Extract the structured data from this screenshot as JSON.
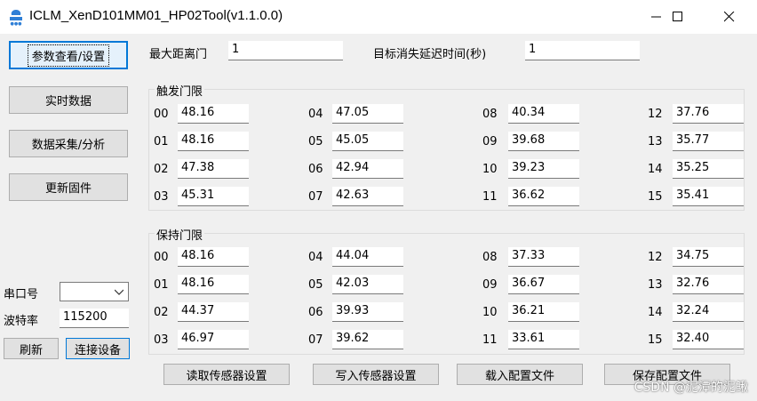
{
  "window": {
    "title": "ICLM_XenD101MM01_HP02Tool(v1.1.0.0)",
    "logo_icon": "app-logo-icon",
    "minimize_icon": "minimize-icon",
    "maximize_icon": "maximize-icon",
    "close_icon": "close-icon"
  },
  "sidebar": {
    "buttons": [
      "参数查看/设置",
      "实时数据",
      "数据采集/分析",
      "更新固件"
    ],
    "selected_index": 0
  },
  "connection": {
    "port_label": "串口号",
    "port_value": "",
    "baud_label": "波特率",
    "baud_value": "115200",
    "refresh_label": "刷新",
    "connect_label": "连接设备"
  },
  "settings": {
    "max_distance_label": "最大距离门",
    "max_distance_value": "1",
    "target_delay_label": "目标消失延迟时间(秒)",
    "target_delay_value": "1"
  },
  "trigger": {
    "title": "触发门限",
    "gates": [
      {
        "id": "00",
        "value": "48.16"
      },
      {
        "id": "01",
        "value": "48.16"
      },
      {
        "id": "02",
        "value": "47.38"
      },
      {
        "id": "03",
        "value": "45.31"
      },
      {
        "id": "04",
        "value": "47.05"
      },
      {
        "id": "05",
        "value": "45.05"
      },
      {
        "id": "06",
        "value": "42.94"
      },
      {
        "id": "07",
        "value": "42.63"
      },
      {
        "id": "08",
        "value": "40.34"
      },
      {
        "id": "09",
        "value": "39.68"
      },
      {
        "id": "10",
        "value": "39.23"
      },
      {
        "id": "11",
        "value": "36.62"
      },
      {
        "id": "12",
        "value": "37.76"
      },
      {
        "id": "13",
        "value": "35.77"
      },
      {
        "id": "14",
        "value": "35.25"
      },
      {
        "id": "15",
        "value": "35.41"
      }
    ]
  },
  "hold": {
    "title": "保持门限",
    "gates": [
      {
        "id": "00",
        "value": "48.16"
      },
      {
        "id": "01",
        "value": "48.16"
      },
      {
        "id": "02",
        "value": "44.37"
      },
      {
        "id": "03",
        "value": "46.97"
      },
      {
        "id": "04",
        "value": "44.04"
      },
      {
        "id": "05",
        "value": "42.03"
      },
      {
        "id": "06",
        "value": "39.93"
      },
      {
        "id": "07",
        "value": "39.62"
      },
      {
        "id": "08",
        "value": "37.33"
      },
      {
        "id": "09",
        "value": "36.67"
      },
      {
        "id": "10",
        "value": "36.21"
      },
      {
        "id": "11",
        "value": "33.61"
      },
      {
        "id": "12",
        "value": "34.75"
      },
      {
        "id": "13",
        "value": "32.76"
      },
      {
        "id": "14",
        "value": "32.24"
      },
      {
        "id": "15",
        "value": "32.40"
      }
    ]
  },
  "actions": {
    "read_label": "读取传感器设置",
    "write_label": "写入传感器设置",
    "load_label": "载入配置文件",
    "save_label": "保存配置文件"
  },
  "watermark": "CSDN @泥潭的泥鳅"
}
